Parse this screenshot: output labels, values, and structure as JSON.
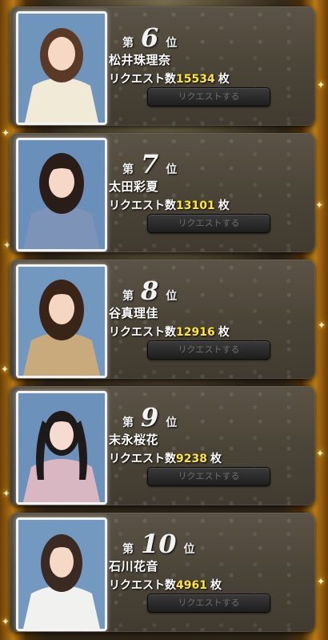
{
  "rankings": [
    {
      "rank_prefix": "第",
      "rank": "6",
      "rank_suffix": "位",
      "name": "松井珠理奈",
      "request_label": "リクエスト数",
      "count": "15534",
      "unit": "枚",
      "button_label": "リクエストする",
      "hair": "#5a3a26",
      "outfit": "#f0ead6"
    },
    {
      "rank_prefix": "第",
      "rank": "7",
      "rank_suffix": "位",
      "name": "太田彩夏",
      "request_label": "リクエスト数",
      "count": "13101",
      "unit": "枚",
      "button_label": "リクエストする",
      "hair": "#2a1d18",
      "outfit": "#7d93b8"
    },
    {
      "rank_prefix": "第",
      "rank": "8",
      "rank_suffix": "位",
      "name": "谷真理佳",
      "request_label": "リクエスト数",
      "count": "12916",
      "unit": "枚",
      "button_label": "リクエストする",
      "hair": "#3a2418",
      "outfit": "#c9aa7c"
    },
    {
      "rank_prefix": "第",
      "rank": "9",
      "rank_suffix": "位",
      "name": "末永桜花",
      "request_label": "リクエスト数",
      "count": "9238",
      "unit": "枚",
      "button_label": "リクエストする",
      "hair": "#1f1a1a",
      "outfit": "#d9b7c2"
    },
    {
      "rank_prefix": "第",
      "rank": "10",
      "rank_suffix": "位",
      "name": "石川花音",
      "request_label": "リクエスト数",
      "count": "4961",
      "unit": "枚",
      "button_label": "リクエストする",
      "hair": "#3a2a22",
      "outfit": "#f1f1ef"
    }
  ]
}
